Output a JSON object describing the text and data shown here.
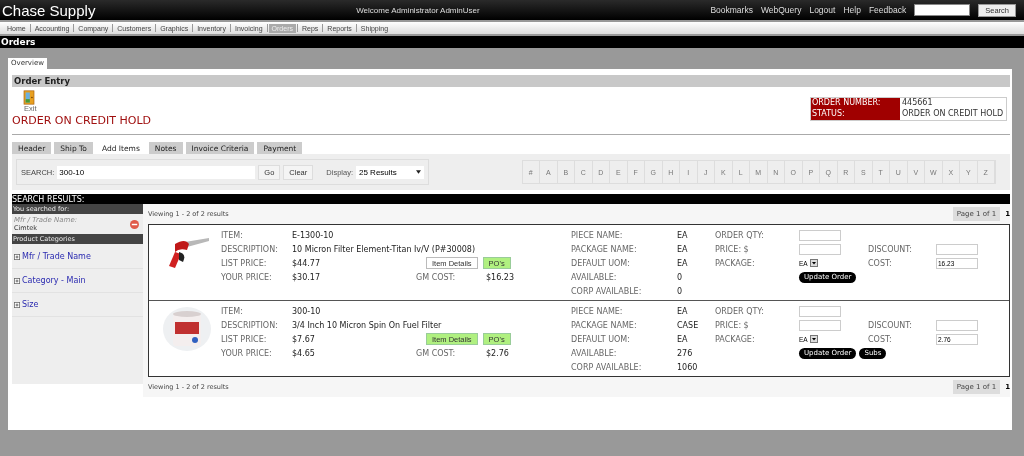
{
  "app": {
    "title": "Chase Supply",
    "welcome": "Welcome  Administrator AdminUser",
    "links": [
      "Bookmarks",
      "WebQuery",
      "Logout",
      "Help",
      "Feedback"
    ],
    "search_button": "Search"
  },
  "menu": [
    {
      "label": "Home",
      "selected": false
    },
    {
      "label": "Accounting",
      "selected": false
    },
    {
      "label": "Company",
      "selected": false
    },
    {
      "label": "Customers",
      "selected": false
    },
    {
      "label": "Graphics",
      "selected": false
    },
    {
      "label": "Inventory",
      "selected": false
    },
    {
      "label": "Invoicing",
      "selected": false
    },
    {
      "label": "Orders",
      "selected": true
    },
    {
      "label": "Reps",
      "selected": false
    },
    {
      "label": "Reports",
      "selected": false
    },
    {
      "label": "Shipping",
      "selected": false
    }
  ],
  "page_title": "Orders",
  "page_tabs": [
    {
      "label": "Overview",
      "selected": true
    }
  ],
  "section_title": "Order Entry",
  "exit_label": "Exit",
  "alert": "ORDER ON CREDIT HOLD",
  "order_info": [
    {
      "label": "ORDER NUMBER:",
      "value": "445661"
    },
    {
      "label": "STATUS:",
      "value": "ORDER ON CREDIT HOLD"
    }
  ],
  "tabs": [
    {
      "label": "Header",
      "selected": false
    },
    {
      "label": "Ship To",
      "selected": false
    },
    {
      "label": "Add Items",
      "selected": true
    },
    {
      "label": "Notes",
      "selected": false
    },
    {
      "label": "Invoice Criteria",
      "selected": false
    },
    {
      "label": "Payment",
      "selected": false
    }
  ],
  "search": {
    "label": "SEARCH:",
    "value": "300-10",
    "buttons": [
      "Go",
      "Clear"
    ],
    "display_label": "Display:",
    "display_value": "25 Results"
  },
  "letters": [
    "#",
    "A",
    "B",
    "C",
    "D",
    "E",
    "F",
    "G",
    "H",
    "I",
    "J",
    "K",
    "L",
    "M",
    "N",
    "O",
    "P",
    "Q",
    "R",
    "S",
    "T",
    "U",
    "V",
    "W",
    "X",
    "Y",
    "Z"
  ],
  "results_title": "SEARCH RESULTS:",
  "sidebar": {
    "searched_header": "You searched for:",
    "filters": [
      {
        "name": "Mfr / Trade Name:",
        "value": "Cimtek"
      }
    ],
    "categories_header": "Product Categories",
    "categories": [
      {
        "label": "Mfr / Trade Name",
        "expanded": false
      },
      {
        "label": "Category - Main",
        "expanded": false
      },
      {
        "label": "Size",
        "expanded": false
      }
    ]
  },
  "viewing_top": "Viewing 1 - 2 of 2 results",
  "pager_top": {
    "label": "Page 1 of 1",
    "page": "1"
  },
  "items": [
    {
      "main": [
        {
          "label": "ITEM:",
          "value": "E-1300-10"
        },
        {
          "label": "DESCRIPTION:",
          "value": "10 Micron Filter Element-Titan Iv/V (P#30008)"
        },
        {
          "label": "LIST PRICE:",
          "value": "$44.77"
        },
        {
          "label": "YOUR PRICE:",
          "value": "$30.17"
        }
      ],
      "buttons": [
        {
          "label": "Item Details",
          "highlighted": false
        },
        {
          "label": "PO's",
          "highlighted": true
        }
      ],
      "gm_cost": {
        "label": "GM COST:",
        "value": "$16.23"
      },
      "stock": [
        {
          "label": "PIECE NAME:",
          "value": "EA"
        },
        {
          "label": "PACKAGE NAME:",
          "value": "EA"
        },
        {
          "label": "DEFAULT UOM:",
          "value": "EA"
        },
        {
          "label": "AVAILABLE:",
          "value": "0"
        },
        {
          "label": "CORP AVAILABLE:",
          "value": "0"
        }
      ],
      "order": {
        "qty_label": "ORDER QTY:",
        "price_label": "PRICE: $",
        "package_label": "PACKAGE:",
        "package": "EA",
        "discount_label": "DISCOUNT:",
        "cost_label": "COST:",
        "cost": "16.23",
        "actions": [
          "Update Order"
        ]
      }
    },
    {
      "main": [
        {
          "label": "ITEM:",
          "value": "300-10"
        },
        {
          "label": "DESCRIPTION:",
          "value": "3/4 Inch 10 Micron Spin On Fuel Filter"
        },
        {
          "label": "LIST PRICE:",
          "value": "$7.67"
        },
        {
          "label": "YOUR PRICE:",
          "value": "$4.65"
        }
      ],
      "buttons": [
        {
          "label": "Item Details",
          "highlighted": true
        },
        {
          "label": "PO's",
          "highlighted": true
        }
      ],
      "gm_cost": {
        "label": "GM COST:",
        "value": "$2.76"
      },
      "stock": [
        {
          "label": "PIECE NAME:",
          "value": "EA"
        },
        {
          "label": "PACKAGE NAME:",
          "value": "CASE"
        },
        {
          "label": "DEFAULT UOM:",
          "value": "EA"
        },
        {
          "label": "AVAILABLE:",
          "value": "276"
        },
        {
          "label": "CORP AVAILABLE:",
          "value": "1060"
        }
      ],
      "order": {
        "qty_label": "ORDER QTY:",
        "price_label": "PRICE: $",
        "package_label": "PACKAGE:",
        "package": "EA",
        "discount_label": "DISCOUNT:",
        "cost_label": "COST:",
        "cost": "2.76",
        "actions": [
          "Update Order",
          "Subs"
        ]
      }
    }
  ],
  "viewing_bottom": "Viewing 1 - 2 of 2 results",
  "pager_bottom": {
    "label": "Page 1 of 1",
    "page": "1"
  }
}
